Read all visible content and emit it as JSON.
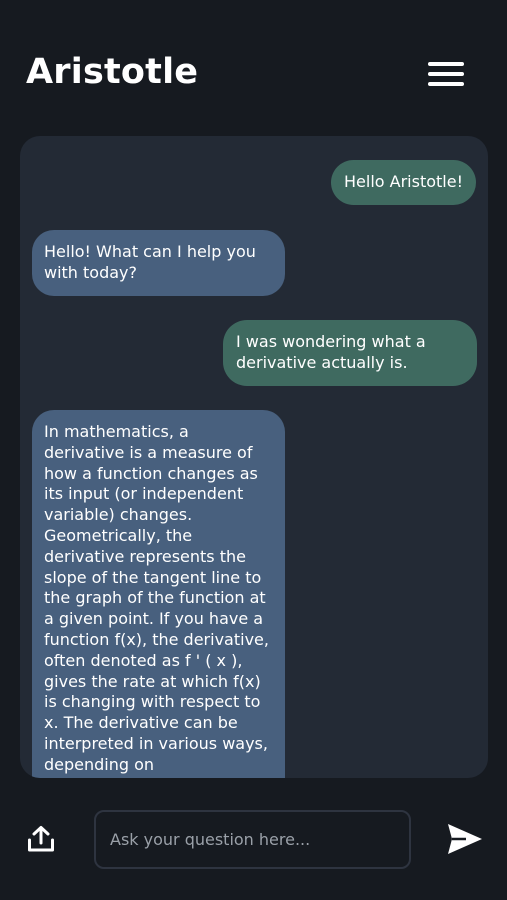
{
  "header": {
    "title": "Aristotle",
    "menu_icon": "hamburger-menu-icon"
  },
  "chat": {
    "messages": [
      {
        "role": "user",
        "text": "Hello Aristotle!"
      },
      {
        "role": "assistant",
        "text": "Hello! What can I help you with today?"
      },
      {
        "role": "user",
        "text": "I was wondering what a derivative actually is."
      },
      {
        "role": "assistant",
        "text": "In mathematics, a derivative is a measure of how a function changes as its input (or independent variable) changes. Geometrically, the derivative represents the slope of the tangent line to the graph of the function at a given point. If you have a function  f(x), the derivative, often denoted as f ' ( x ), gives the rate at which f(x) is changing with respect to x.  The derivative can be interpreted in various ways, depending on"
      }
    ]
  },
  "composer": {
    "placeholder": "Ask your question here...",
    "value": "",
    "upload_icon": "upload-icon",
    "send_icon": "send-icon"
  },
  "colors": {
    "background": "#161a20",
    "panel": "#232a35",
    "user_bubble": "#3f6a60",
    "assistant_bubble": "#48607e"
  }
}
